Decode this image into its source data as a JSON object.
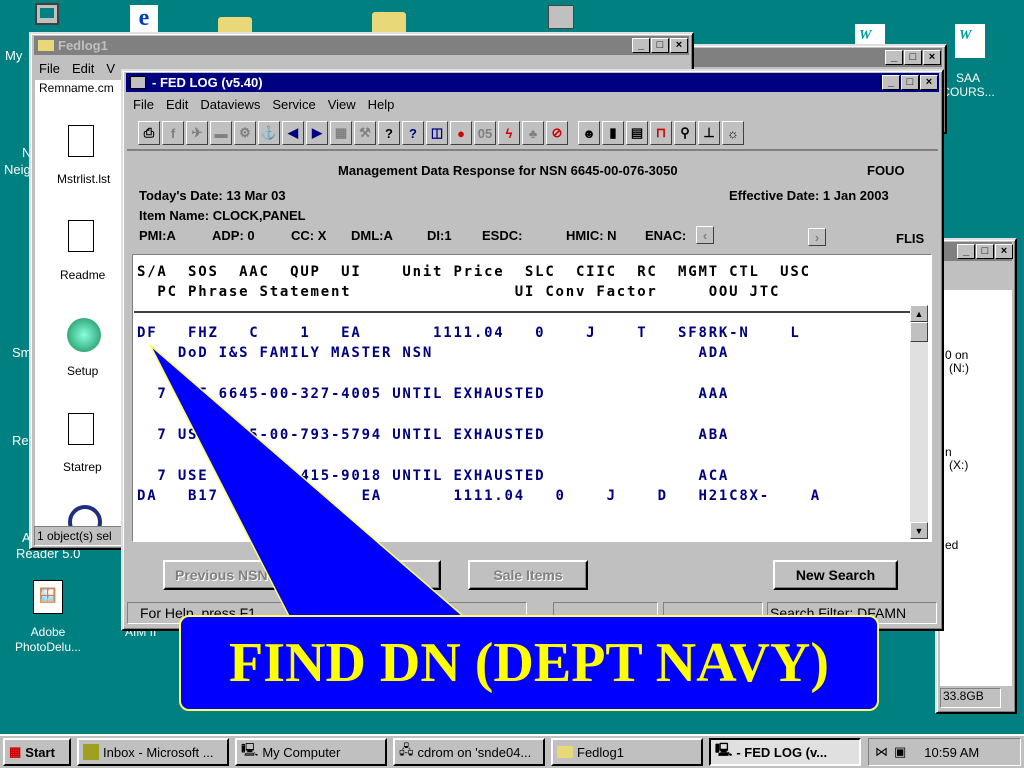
{
  "desktop": {
    "left_labels": [
      "My",
      "N",
      "Neig",
      "Sm",
      "Re",
      "A",
      "Reader 5.0"
    ],
    "adobe": "Adobe\nPhotoDelu...",
    "aim": "AIM II",
    "saa": "SAA\nCOURS...",
    "colors": {
      "desktop": "#008080",
      "titlebar": "#000080",
      "text": "#000080",
      "callout": "#0000ff",
      "callout_text": "#ffff00"
    }
  },
  "fedlog1": {
    "title": "Fedlog1",
    "menu": [
      "File",
      "Edit",
      "V"
    ],
    "clipped_top": "Remname.cm",
    "files": [
      "Mstrlist.lst",
      "Readme",
      "Setup",
      "Statrep"
    ],
    "status": "1 object(s) sel"
  },
  "right_window": {
    "lines": [
      "0 on",
      "(N:)",
      "n",
      "(X:)",
      "ed",
      "33.8GB"
    ]
  },
  "main": {
    "title": "- FED LOG (v5.40)",
    "menu": [
      "File",
      "Edit",
      "Dataviews",
      "Service",
      "View",
      "Help"
    ],
    "toolbar": [
      "printer",
      "flis",
      "aircraft",
      "tank",
      "ship-gear",
      "anchor",
      "prev-arrow",
      "next-arrow",
      "grid",
      "wrench",
      "help",
      "context-help",
      "columns",
      "apple",
      "05",
      "lightning",
      "tree",
      "no-sign",
      "face",
      "bar-chart",
      "book",
      "cart",
      "magnifier",
      "tool",
      "lightbulb"
    ],
    "heading": "Management Data Response for NSN  6645-00-076-3050",
    "fouo": "FOUO",
    "todays_date": "Today's Date: 13 Mar 03",
    "effective_date": "Effective Date: 1 Jan 2003",
    "item_name": "Item Name: CLOCK,PANEL",
    "codes": {
      "pmi": "PMI:A",
      "adp": "ADP: 0",
      "cc": "CC: X",
      "dml": "DML:A",
      "di": "DI:1",
      "esdc": "ESDC:",
      "hmic": "HMIC: N",
      "enac": "ENAC:"
    },
    "flis": "FLIS",
    "table": {
      "header1": "S/A  SOS  AAC  QUP  UI    Unit Price  SLC  CIIC  RC  MGMT CTL  USC",
      "header2": "  PC Phrase Statement                UI Conv Factor     OOU JTC",
      "rows": [
        "DF   FHZ   C    1   EA       1111.04   0    J    T   SF8RK-N    L",
        "    DoD I&S FAMILY MASTER NSN                          ADA",
        "  7 USE 6645-00-327-4005 UNTIL EXHAUSTED                ",
        "                                                       AAA",
        "  7 US     5-00-793-5794 UNTIL EXHAUSTED",
        "                                                       ABA",
        "  7 USE         415-9018 UNTIL EXHAUSTED",
        "                                                       ACA",
        "DA   B17              EA       1111.04   0    J    D   H21C8X-    A"
      ]
    },
    "buttons": {
      "previous": "Previous NSN",
      "sale": "Sale Items",
      "new_search": "New Search"
    },
    "status_help": "For Help, press F1",
    "status_filter": "Search Filter: DFAMN"
  },
  "callout": "FIND DN (DEPT NAVY)",
  "taskbar": {
    "start": "Start",
    "items": [
      "Inbox - Microsoft ...",
      "My Computer",
      "cdrom on 'snde04...",
      "Fedlog1",
      "- FED LOG (v..."
    ],
    "time": "10:59 AM"
  }
}
